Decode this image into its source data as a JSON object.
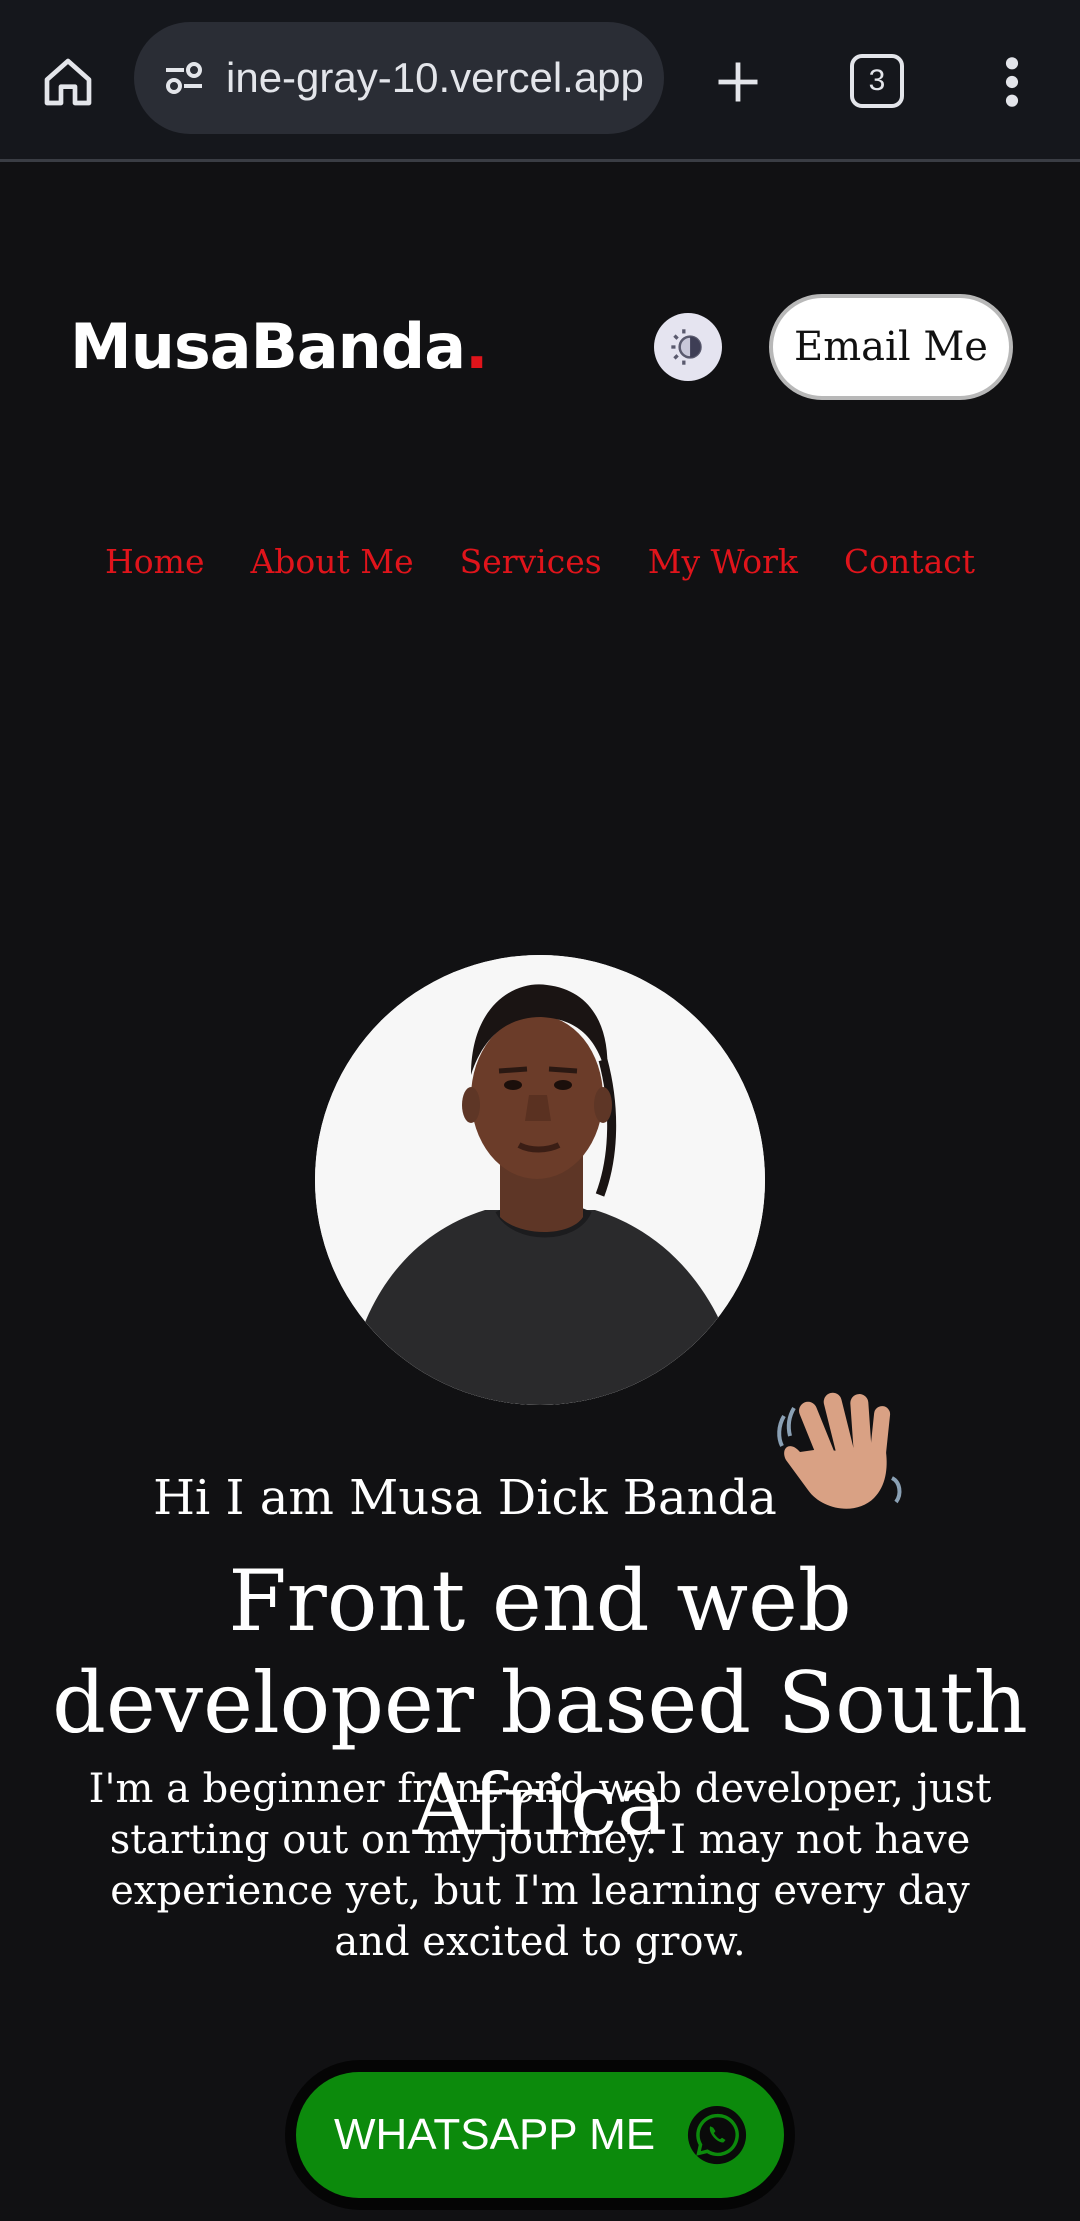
{
  "browser": {
    "url": "ine-gray-10.vercel.app",
    "tab_count": "3"
  },
  "header": {
    "logo_text": "MusaBanda",
    "logo_dot": ".",
    "email_button": "Email Me"
  },
  "nav": {
    "items": [
      "Home",
      "About Me",
      "Services",
      "My Work",
      "Contact"
    ]
  },
  "hero": {
    "greeting": "Hi I am Musa Dick Banda",
    "headline": "Front end web developer based South Africa",
    "bio": "I'm a beginner front-end web developer, just starting out on my journey. I may not have experience yet, but I'm learning every day and excited to grow.",
    "whatsapp_button": "WHATSAPP ME"
  },
  "colors": {
    "background": "#111113",
    "accent": "#e0141b",
    "whatsapp_green": "#0c8a0c"
  },
  "icons": {
    "home": "home-icon",
    "site_info": "site-info-icon",
    "new_tab": "plus-icon",
    "menu": "more-vert-icon",
    "theme": "theme-toggle-icon",
    "wave": "waving-hand-icon",
    "whatsapp": "whatsapp-icon"
  }
}
